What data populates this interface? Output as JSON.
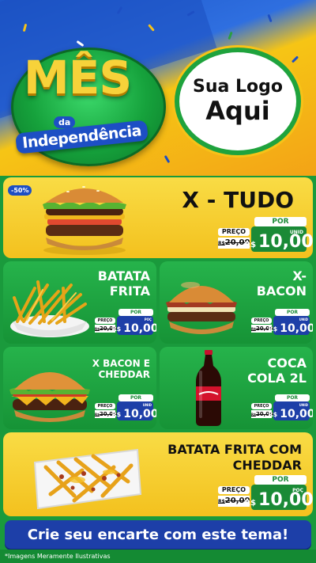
{
  "header": {
    "title_big": "MÊS",
    "title_da": "da",
    "title_sub": "Independência",
    "logo_line1": "Sua Logo",
    "logo_line2": "Aqui"
  },
  "colors": {
    "green": "#1a9a3c",
    "yellow": "#f3c11e",
    "blue": "#1d4fc4",
    "dark_blue": "#1d3fa8"
  },
  "featured": {
    "discount": "-50%",
    "name": "X - TUDO",
    "por": "POR",
    "preco": "PREÇO",
    "old_prefix": "R$",
    "old_price": "20,00",
    "currency": "R$",
    "new_price": "10,00",
    "unit": "UNID"
  },
  "items": [
    {
      "name_l1": "BATATA",
      "name_l2": "FRITA",
      "por": "POR",
      "preco": "PREÇO",
      "old_prefix": "R$",
      "old_price": "20,00",
      "currency": "R$",
      "new_price": "10,00",
      "unit": "POÇ"
    },
    {
      "name_l1": "X-",
      "name_l2": "BACON",
      "por": "POR",
      "preco": "PREÇO",
      "old_prefix": "R$",
      "old_price": "20,00",
      "currency": "R$",
      "new_price": "10,00",
      "unit": "UNID"
    },
    {
      "name_l1": "X BACON E",
      "name_l2": "CHEDDAR",
      "por": "POR",
      "preco": "PREÇO",
      "old_prefix": "R$",
      "old_price": "20,00",
      "currency": "R$",
      "new_price": "10,00",
      "unit": "UNID"
    },
    {
      "name_l1": "COCA",
      "name_l2": "COLA 2L",
      "por": "POR",
      "preco": "PREÇO",
      "old_prefix": "R$",
      "old_price": "20,00",
      "currency": "R$",
      "new_price": "10,00",
      "unit": "UNID"
    }
  ],
  "bottom_item": {
    "name_l1": "BATATA FRITA COM",
    "name_l2": "CHEDDAR",
    "por": "POR",
    "preco": "PREÇO",
    "old_prefix": "R$",
    "old_price": "20,00",
    "currency": "R$",
    "new_price": "10,00",
    "unit": "POÇ"
  },
  "cta": "Crie seu encarte com este tema!",
  "disclaimer": "*Imagens Meramente Ilustrativas"
}
